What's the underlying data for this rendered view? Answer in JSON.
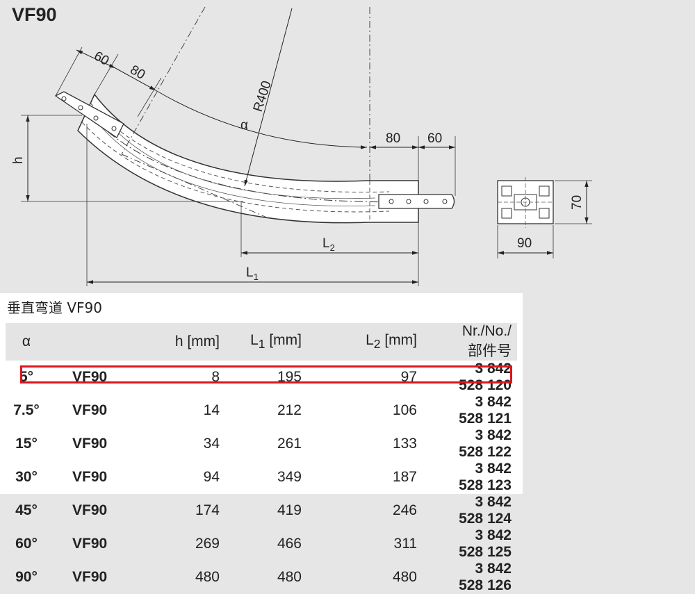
{
  "title": "VF90",
  "drawing": {
    "dim_60_left": "60",
    "dim_80_left": "80",
    "alpha": "α",
    "radius": "R400",
    "dim_80_right": "80",
    "dim_60_right": "60",
    "h_label": "h",
    "L2_main": "L",
    "L2_sub": "2",
    "L1_main": "L",
    "L1_sub": "1",
    "section_height": "70",
    "section_width": "90"
  },
  "table": {
    "caption": "垂直弯道 VF90",
    "headers": {
      "alpha": "α",
      "type": "",
      "h": "h [mm]",
      "l1_main": "L",
      "l1_sub": "1",
      "l1_unit": " [mm]",
      "l2_main": "L",
      "l2_sub": "2",
      "l2_unit": " [mm]",
      "nr": "Nr./No./部件号"
    },
    "rows": [
      {
        "alpha": "5°",
        "type": "VF90",
        "h": "8",
        "l1": "195",
        "l2": "97",
        "nr": "3 842 528 120"
      },
      {
        "alpha": "7.5°",
        "type": "VF90",
        "h": "14",
        "l1": "212",
        "l2": "106",
        "nr": "3 842 528 121"
      },
      {
        "alpha": "15°",
        "type": "VF90",
        "h": "34",
        "l1": "261",
        "l2": "133",
        "nr": "3 842 528 122"
      },
      {
        "alpha": "30°",
        "type": "VF90",
        "h": "94",
        "l1": "349",
        "l2": "187",
        "nr": "3 842 528 123"
      },
      {
        "alpha": "45°",
        "type": "VF90",
        "h": "174",
        "l1": "419",
        "l2": "246",
        "nr": "3 842 528 124"
      },
      {
        "alpha": "60°",
        "type": "VF90",
        "h": "269",
        "l1": "466",
        "l2": "311",
        "nr": "3 842 528 125"
      },
      {
        "alpha": "90°",
        "type": "VF90",
        "h": "480",
        "l1": "480",
        "l2": "480",
        "nr": "3 842 528 126"
      }
    ],
    "highlight_color": "#e0141b"
  }
}
